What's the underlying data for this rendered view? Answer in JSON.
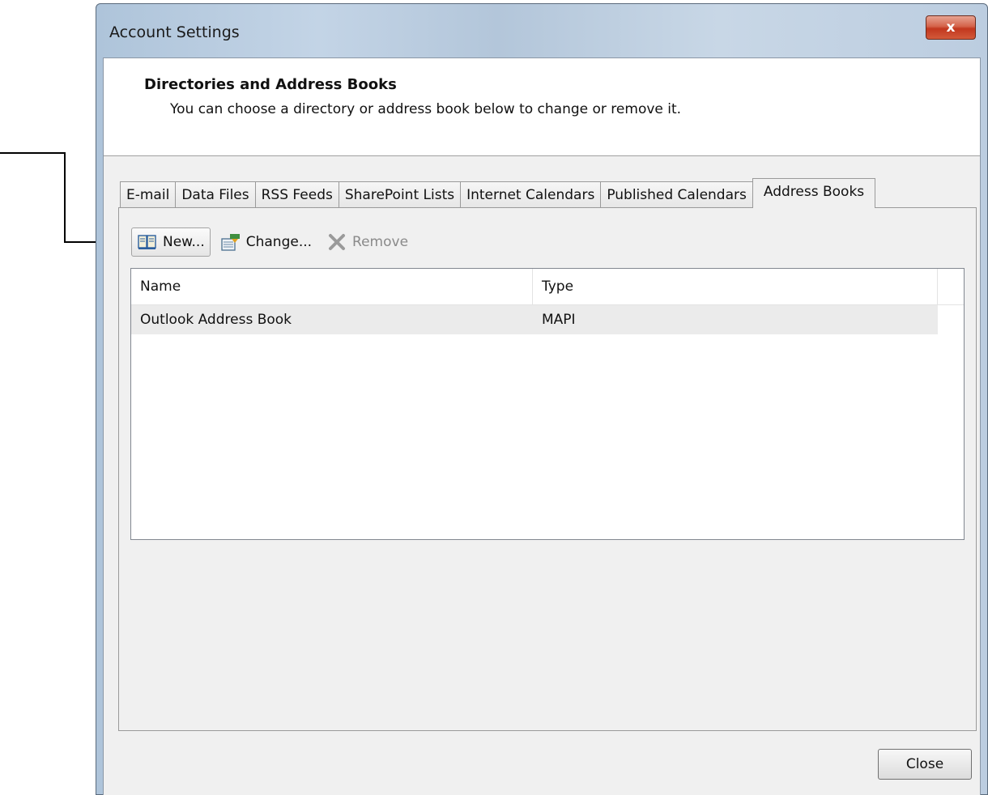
{
  "window": {
    "title": "Account Settings",
    "close_glyph": "x"
  },
  "header": {
    "title": "Directories and Address Books",
    "description": "You can choose a directory or address book below to change or remove it."
  },
  "tabs": [
    {
      "label": "E-mail",
      "active": false
    },
    {
      "label": "Data Files",
      "active": false
    },
    {
      "label": "RSS Feeds",
      "active": false
    },
    {
      "label": "SharePoint Lists",
      "active": false
    },
    {
      "label": "Internet Calendars",
      "active": false
    },
    {
      "label": "Published Calendars",
      "active": false
    },
    {
      "label": "Address Books",
      "active": true
    }
  ],
  "toolbar": {
    "new_label": "New...",
    "new_icon": "address-book-icon",
    "change_label": "Change...",
    "change_icon": "change-icon",
    "remove_label": "Remove",
    "remove_icon": "remove-x-icon"
  },
  "list": {
    "columns": [
      "Name",
      "Type"
    ],
    "rows": [
      {
        "name": "Outlook Address Book",
        "type": "MAPI"
      }
    ]
  },
  "footer": {
    "close_label": "Close"
  },
  "colors": {
    "close_red": "#c2371e",
    "disabled_gray": "#8a8a8a",
    "selected_row": "#ebebeb"
  }
}
